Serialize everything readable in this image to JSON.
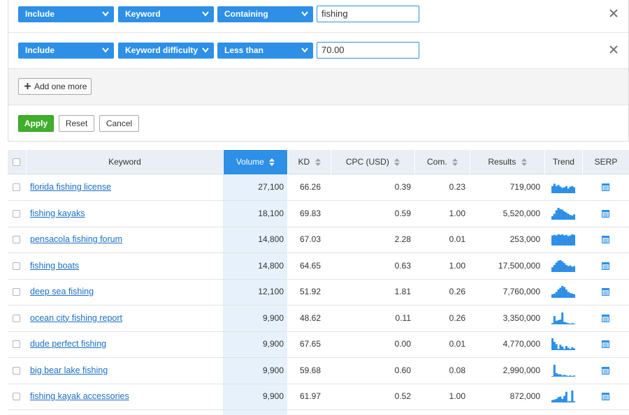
{
  "colors": {
    "accent": "#2d8fe6",
    "apply": "#3fae2a",
    "link": "#1a6fc7",
    "volume_column": "#e6f1fb",
    "header_bg": "#e9eff5"
  },
  "filters": [
    {
      "mode": "Include",
      "field": "Keyword",
      "operator": "Containing",
      "value": "fishing"
    },
    {
      "mode": "Include",
      "field": "Keyword difficulty",
      "operator": "Less than",
      "value": "70.00"
    }
  ],
  "add_label": "Add one more",
  "actions": {
    "apply": "Apply",
    "reset": "Reset",
    "cancel": "Cancel"
  },
  "columns": {
    "keyword": "Keyword",
    "volume": "Volume",
    "kd": "KD",
    "cpc": "CPC (USD)",
    "com": "Com.",
    "results": "Results",
    "trend": "Trend",
    "serp": "SERP"
  },
  "sorted_column": "volume",
  "rows": [
    {
      "keyword": "florida fishing license",
      "volume": "27,100",
      "kd": "66.26",
      "cpc": "0.39",
      "com": "0.23",
      "results": "719,000",
      "trend": [
        0.6,
        0.8,
        0.6,
        0.7,
        0.55,
        0.45,
        0.5,
        0.6,
        0.4,
        0.55,
        0.6,
        0.5
      ]
    },
    {
      "keyword": "fishing kayaks",
      "volume": "18,100",
      "kd": "69.83",
      "cpc": "0.59",
      "com": "1.00",
      "results": "5,520,000",
      "trend": [
        0.3,
        0.5,
        0.8,
        1.0,
        0.9,
        0.85,
        0.7,
        0.6,
        0.5,
        0.4,
        0.35,
        0.45
      ]
    },
    {
      "keyword": "pensacola fishing forum",
      "volume": "14,800",
      "kd": "67.03",
      "cpc": "2.28",
      "com": "0.01",
      "results": "253,000",
      "trend": [
        0.85,
        0.9,
        0.85,
        0.95,
        0.9,
        0.95,
        0.85,
        0.9,
        0.8,
        0.85,
        0.95,
        0.9
      ]
    },
    {
      "keyword": "fishing boats",
      "volume": "14,800",
      "kd": "64.65",
      "cpc": "0.63",
      "com": "1.00",
      "results": "17,500,000",
      "trend": [
        0.4,
        0.6,
        0.8,
        0.95,
        1.0,
        0.9,
        0.75,
        0.6,
        0.5,
        0.55,
        0.45,
        0.5
      ]
    },
    {
      "keyword": "deep sea fishing",
      "volume": "12,100",
      "kd": "51.92",
      "cpc": "1.81",
      "com": "0.26",
      "results": "7,760,000",
      "trend": [
        0.3,
        0.35,
        0.5,
        0.7,
        0.85,
        1.0,
        0.9,
        0.7,
        0.5,
        0.4,
        0.35,
        0.3
      ]
    },
    {
      "keyword": "ocean city fishing report",
      "volume": "9,900",
      "kd": "48.62",
      "cpc": "0.11",
      "com": "0.26",
      "results": "3,350,000",
      "trend": [
        0.1,
        0.7,
        0.3,
        0.35,
        0.4,
        1.0,
        0.2,
        0.15,
        0.1,
        0.05,
        0.1,
        0.05
      ]
    },
    {
      "keyword": "dude perfect fishing",
      "volume": "9,900",
      "kd": "67.65",
      "cpc": "0.00",
      "com": "0.01",
      "results": "4,770,000",
      "trend": [
        1.0,
        0.7,
        0.5,
        0.1,
        0.45,
        0.3,
        0.1,
        0.35,
        0.2,
        0.1,
        0.25,
        0.15
      ]
    },
    {
      "keyword": "big bear lake fishing",
      "volume": "9,900",
      "kd": "59.68",
      "cpc": "0.60",
      "com": "0.08",
      "results": "2,990,000",
      "trend": [
        0.05,
        1.0,
        0.3,
        0.2,
        0.2,
        0.1,
        0.15,
        0.1,
        0.05,
        0.1,
        0.05,
        0.1
      ]
    },
    {
      "keyword": "fishing kayak accessories",
      "volume": "9,900",
      "kd": "61.97",
      "cpc": "0.52",
      "com": "1.00",
      "results": "872,000",
      "trend": [
        0.2,
        0.25,
        0.3,
        0.45,
        0.5,
        0.3,
        0.55,
        0.9,
        0.1,
        0.1,
        1.0,
        0.1
      ]
    }
  ]
}
